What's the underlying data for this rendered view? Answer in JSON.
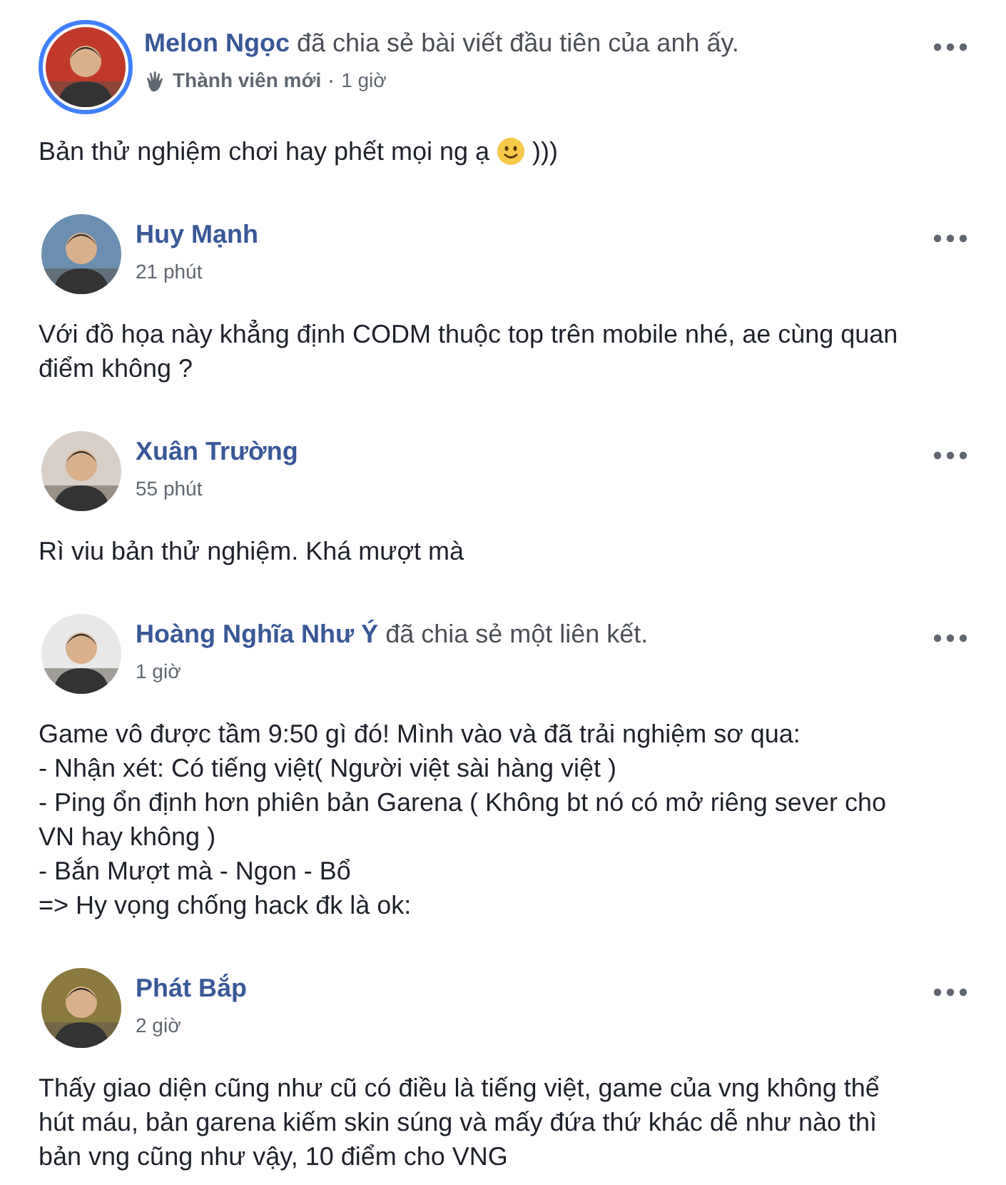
{
  "posts": [
    {
      "author": "Melon Ngọc",
      "action": "đã chia sẻ bài viết đầu tiên của anh ấy.",
      "badge": "Thành viên mới",
      "time": "1 giờ",
      "story_ring": true,
      "avatar": {
        "kind": "picture"
      },
      "body": [
        "Bản thử nghiệm chơi hay phết mọi ng ạ"
      ],
      "body_tail": ")))"
    },
    {
      "author": "Huy Mạnh",
      "time": "21 phút",
      "story_ring": false,
      "avatar": {
        "kind": "picture"
      },
      "body": [
        "Với đồ họa này khẳng định CODM thuộc top trên mobile nhé, ae cùng quan",
        "điểm không ?"
      ]
    },
    {
      "author": "Xuân Trường",
      "time": "55 phút",
      "story_ring": false,
      "avatar": {
        "kind": "picture"
      },
      "body": [
        "Rì viu bản thử nghiệm. Khá mượt mà"
      ]
    },
    {
      "author": "Hoàng Nghĩa Như Ý",
      "action": "đã chia sẻ một liên kết.",
      "time": "1 giờ",
      "story_ring": false,
      "avatar": {
        "kind": "picture"
      },
      "body": [
        "Game vô được tầm 9:50 gì đó! Mình vào và đã trải nghiệm sơ qua:",
        "- Nhận xét: Có tiếng việt( Người việt sài hàng việt )",
        "- Ping ổn định hơn phiên bản Garena ( Không bt nó có mở riêng sever cho",
        "VN hay không )",
        "- Bắn Mượt mà - Ngon - Bổ",
        "=> Hy vọng chống hack đk là ok:"
      ]
    },
    {
      "author": "Phát Bắp",
      "time": "2 giờ",
      "story_ring": false,
      "avatar": {
        "kind": "picture"
      },
      "body": [
        "Thấy giao diện cũng như cũ có điều là tiếng việt, game của vng không thể",
        "hút máu, bản garena kiếm skin súng và mấy đứa thứ khác dễ như nào thì",
        "bản vng cũng như vậy, 10 điểm cho VNG"
      ]
    }
  ]
}
